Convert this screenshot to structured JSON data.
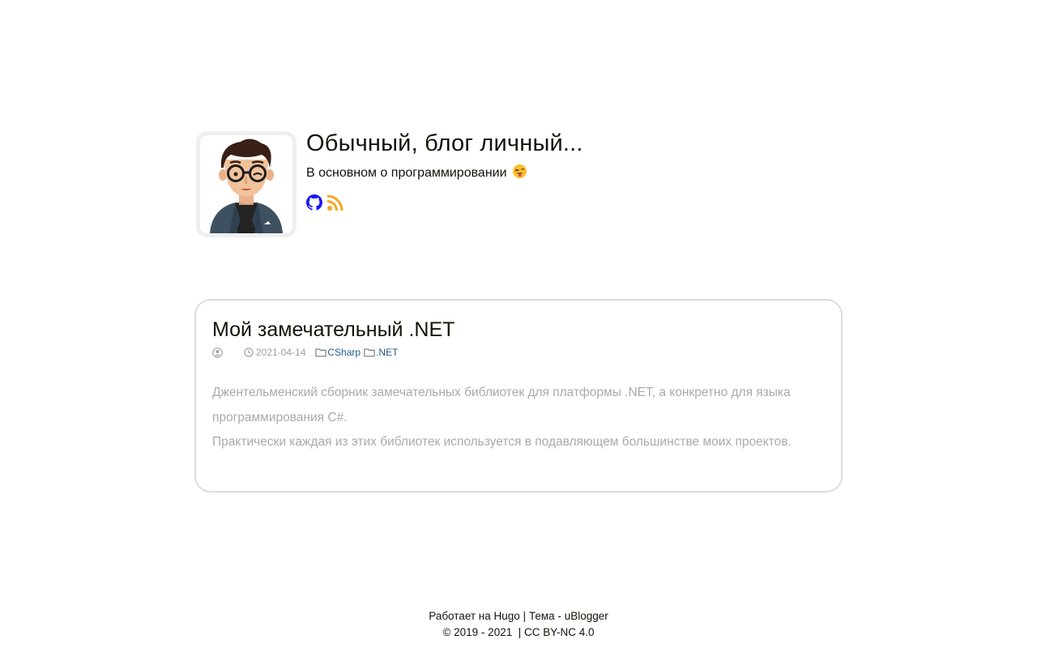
{
  "site": {
    "title": "Обычный, блог личный...",
    "subtitle": "В основном о программировании",
    "subtitle_emoji": "winking-face-with-tongue",
    "social": [
      {
        "icon": "github-icon",
        "color": "#1a17f0"
      },
      {
        "icon": "rss-icon",
        "color": "#f5a623"
      }
    ]
  },
  "post": {
    "title": "Мой замечательный .NET",
    "date": "2021-04-14",
    "categories": [
      "CSharp",
      ".NET"
    ],
    "summary": [
      "Джентельменский сборник замечательных библиотек для платформы .NET, а конкретно для языка программирования C#.",
      "Практически каждая из этих библиотек используется в подавляющем большинстве моих проектов."
    ]
  },
  "footer": {
    "powered_prefix": "Работает на",
    "powered_link": "Hugo",
    "separator": "|",
    "theme_prefix": "Тема -",
    "theme_link": "uBlogger",
    "copyright": "© 2019 - 2021",
    "license_separator": "|",
    "license": "CC BY-NC 4.0"
  },
  "colors": {
    "link": "#1e5c90",
    "muted": "#a0a0a0",
    "summary": "#a9a9b1",
    "card_border": "#dcdcdc"
  }
}
